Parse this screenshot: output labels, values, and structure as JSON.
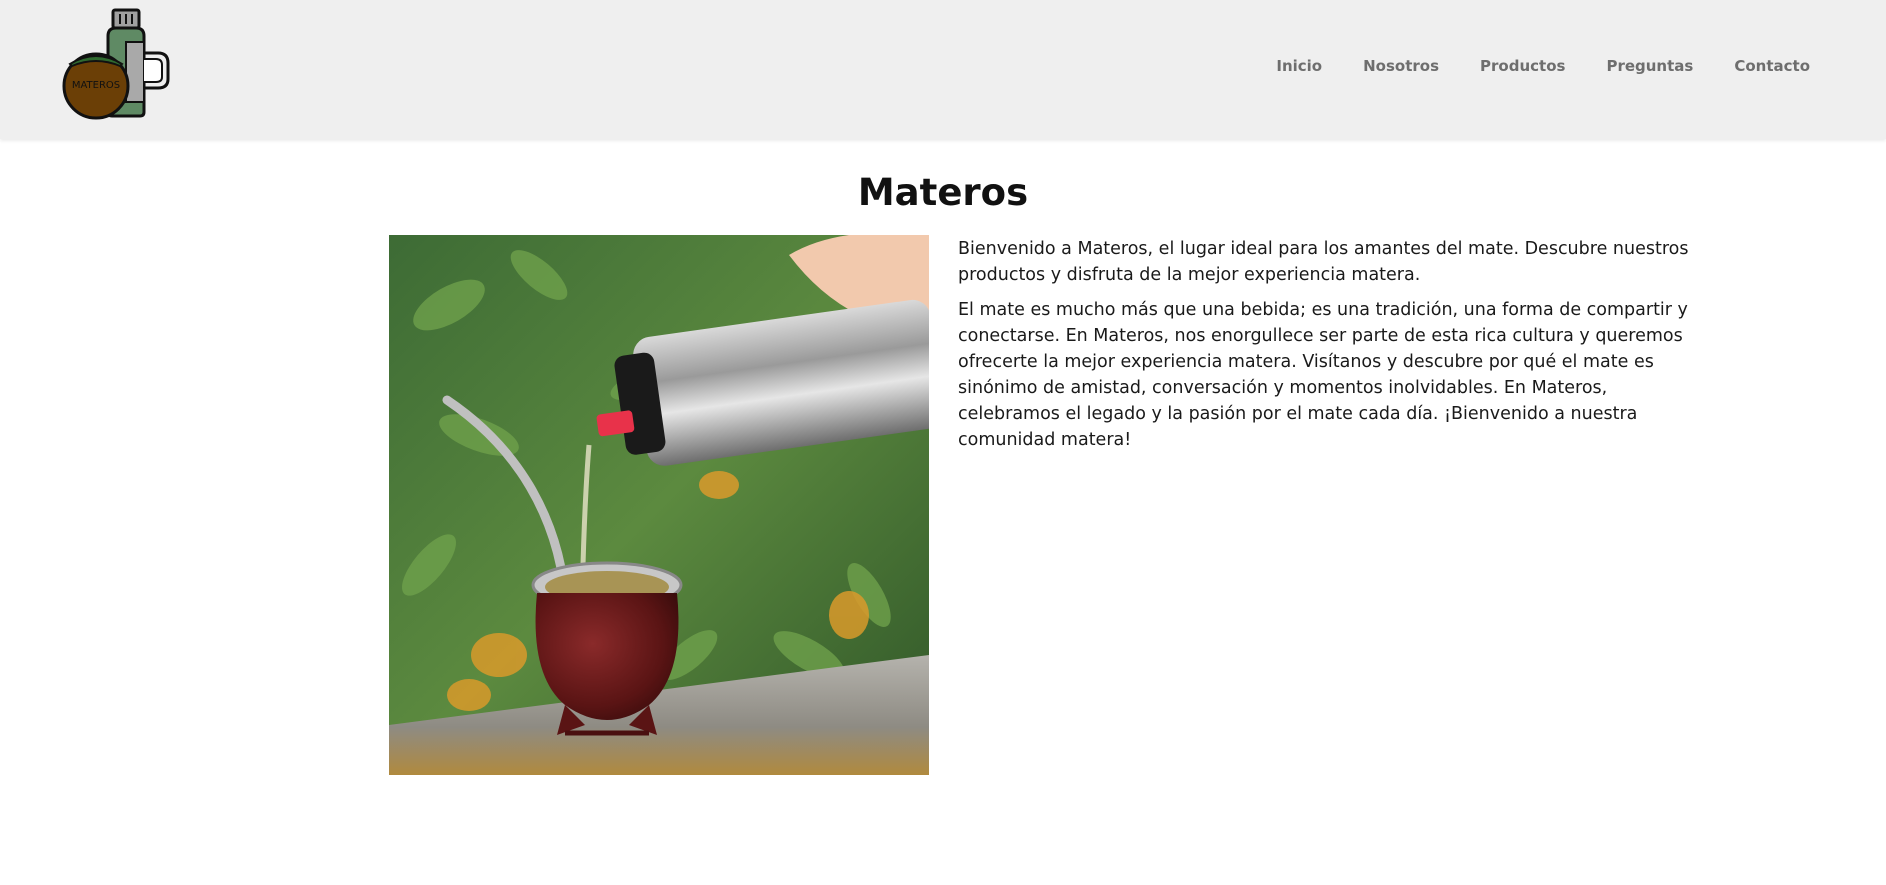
{
  "brand": {
    "logo_text": "MATEROS"
  },
  "nav": {
    "items": [
      {
        "label": "Inicio"
      },
      {
        "label": "Nosotros"
      },
      {
        "label": "Productos"
      },
      {
        "label": "Preguntas"
      },
      {
        "label": "Contacto"
      }
    ]
  },
  "main": {
    "title": "Materos",
    "image_icon": "mate-pouring-photo",
    "paragraphs": [
      "Bienvenido a Materos, el lugar ideal para los amantes del mate. Descubre nuestros productos y disfruta de la mejor experiencia matera.",
      "El mate es mucho más que una bebida; es una tradición, una forma de compartir y conectarse. En Materos, nos enorgullece ser parte de esta rica cultura y queremos ofrecerte la mejor experiencia matera. Visítanos y descubre por qué el mate es sinónimo de amistad, conversación y momentos inolvidables. En Materos, celebramos el legado y la pasión por el mate cada día. ¡Bienvenido a nuestra comunidad matera!"
    ]
  },
  "colors": {
    "header_bg": "#efefef",
    "nav_text": "#6e6e6e",
    "title_text": "#111111",
    "logo_mate": "#6b3f06",
    "logo_thermos": "#5f8a64"
  }
}
